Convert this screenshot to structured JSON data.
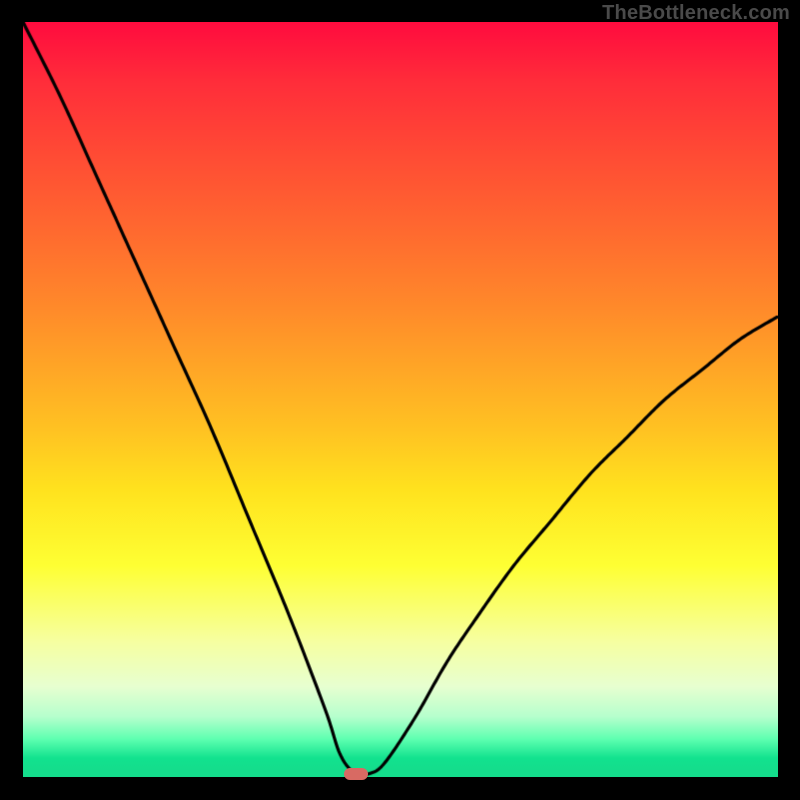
{
  "watermark": "TheBottleneck.com",
  "chart_data": {
    "type": "line",
    "title": "",
    "xlabel": "",
    "ylabel": "",
    "xlim": [
      0,
      100
    ],
    "ylim": [
      0,
      100
    ],
    "grid": false,
    "marker": {
      "x": 44,
      "y": 0.5,
      "color": "#d86a63"
    },
    "series": [
      {
        "name": "curve",
        "x": [
          0,
          5,
          10,
          15,
          20,
          25,
          30,
          35,
          40,
          42,
          44,
          46,
          48,
          52,
          56,
          60,
          65,
          70,
          75,
          80,
          85,
          90,
          95,
          100
        ],
        "y": [
          100,
          90,
          79,
          68,
          57,
          46,
          34,
          22,
          9,
          3,
          0.5,
          0.5,
          2,
          8,
          15,
          21,
          28,
          34,
          40,
          45,
          50,
          54,
          58,
          61
        ]
      }
    ],
    "background_gradient": {
      "stops": [
        {
          "pct": 0,
          "color": "#ff0b3e"
        },
        {
          "pct": 38,
          "color": "#ff8a2a"
        },
        {
          "pct": 72,
          "color": "#feff33"
        },
        {
          "pct": 95,
          "color": "#5dffb0"
        },
        {
          "pct": 100,
          "color": "#14dd8c"
        }
      ]
    }
  }
}
